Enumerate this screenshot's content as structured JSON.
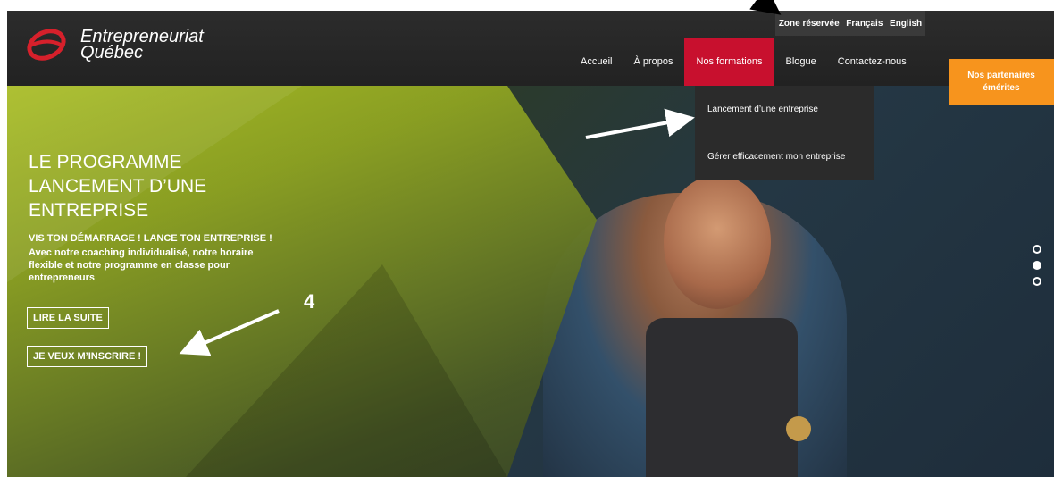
{
  "logo": {
    "line1": "Entrepreneuriat",
    "line2": "Québec"
  },
  "utility_nav": [
    "Zone réservée",
    "Français",
    "English"
  ],
  "main_nav": [
    {
      "label": "Accueil",
      "active": false
    },
    {
      "label": "À propos",
      "active": false
    },
    {
      "label": "Nos formations",
      "active": true
    },
    {
      "label": "Blogue",
      "active": false
    },
    {
      "label": "Contactez-nous",
      "active": false
    }
  ],
  "dropdown": [
    "Lancement d’une entreprise",
    "Gérer efficacement mon entreprise"
  ],
  "partners": {
    "label": "Nos partenaires émérites"
  },
  "hero": {
    "title": "LE PROGRAMME LANCEMENT D’UNE ENTREPRISE",
    "subtitle": "VIS TON DÉMARRAGE ! LANCE TON ENTREPRISE !",
    "description": "Avec notre coaching individualisé, notre horaire flexible et notre programme en classe pour entrepreneurs",
    "btn_read": "LIRE LA SUITE",
    "btn_register": "JE VEUX M’INSCRIRE !"
  },
  "carousel": {
    "count": 3,
    "active_index": 1
  },
  "annotation": {
    "step_label": "4"
  },
  "colors": {
    "accent_red": "#c8102e",
    "partners_orange": "#f7941d",
    "topbar": "#262626",
    "hero_green": "#8ea322"
  }
}
